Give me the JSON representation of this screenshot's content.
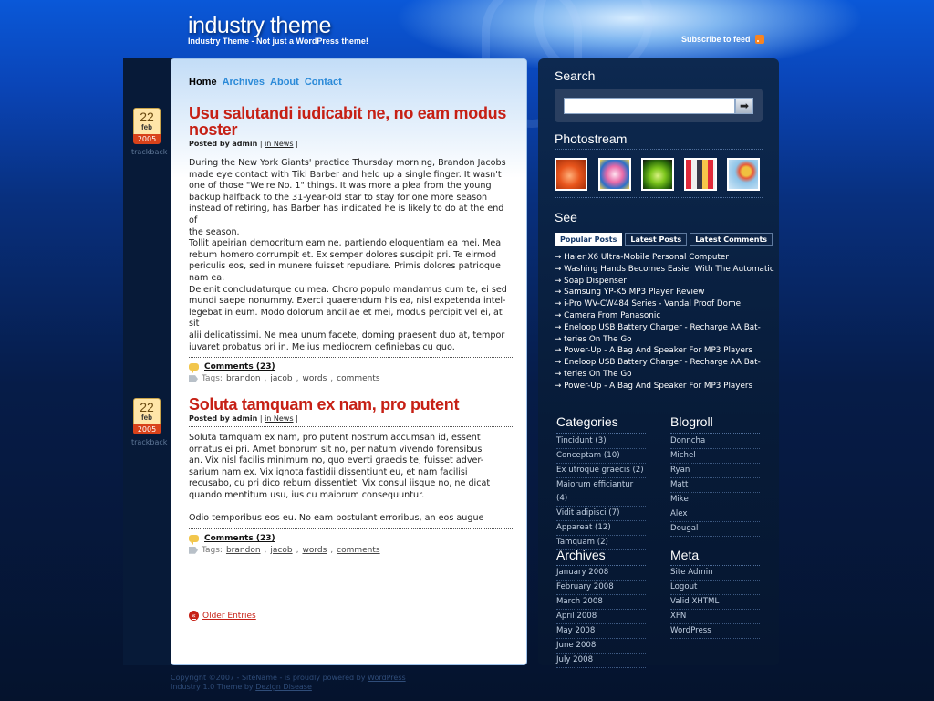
{
  "header": {
    "site_title": "industry theme",
    "tagline": "Industry Theme - Not just a WordPress theme!",
    "subscribe_label": "Subscribe to feed"
  },
  "nav": [
    "Home",
    "Archives",
    "About",
    "Contact"
  ],
  "posts": [
    {
      "date": {
        "day": "22",
        "month": "feb",
        "year": "2005"
      },
      "trackback": "trackback",
      "title_lines": [
        "Usu salutandi iudicabit ne, no eam modus",
        "noster"
      ],
      "meta": {
        "posted_by_label": "Posted by",
        "author": "admin",
        "category": "in News"
      },
      "body_lines": [
        "During the New York Giants' practice Thursday morning, Brandon Jacobs",
        "made eye contact with Tiki Barber and held up a single finger. It wasn't",
        "one of those \"We're No. 1\" things. It was more a plea from the young",
        "backup halfback to the 31-year-old star to stay for one more season",
        "instead of retiring, has Barber has indicated he is likely to do at the end of",
        "the season.",
        "Tollit apeirian democritum eam ne, partiendo eloquentiam ea mei. Mea",
        "rebum homero corrumpit et. Ex semper dolores suscipit pri. Te eirmod",
        "periculis eos, sed in munere fuisset repudiare. Primis dolores patrioque",
        "nam ea.",
        "Delenit concludaturque cu mea. Choro populo mandamus cum te, ei sed",
        "mundi saepe nonummy. Exerci quaerendum his ea, nisl expetenda intel-",
        "legebat in eum. Modo dolorum ancillae et mei, modus percipit vel ei, at sit",
        "alii delicatissimi. Ne mea unum facete, doming praesent duo at, tempor",
        "iuvaret probatus pri in. Melius mediocrem definiebas cu quo."
      ],
      "comments_label": "Comments (23)",
      "tags_label": "Tags:",
      "tags": [
        "brandon",
        "jacob",
        "words",
        "comments"
      ]
    },
    {
      "date": {
        "day": "22",
        "month": "feb",
        "year": "2005"
      },
      "trackback": "trackback",
      "title_lines": [
        "Soluta tamquam ex nam, pro putent"
      ],
      "meta": {
        "posted_by_label": "Posted by",
        "author": "admin",
        "category": "in News"
      },
      "body_lines": [
        "Soluta tamquam ex nam, pro putent nostrum accumsan id, essent",
        "ornatus ei pri. Amet bonorum sit no, per natum vivendo forensibus",
        "an. Vix nisl facilis minimum no, quo everti graecis te, fuisset adver-",
        "sarium nam ex. Vix ignota fastidii dissentiunt eu, et nam facilisi",
        "recusabo, cu pri dico rebum dissentiet. Vix consul iisque no, ne dicat",
        "quando mentitum usu, ius cu maiorum consequuntur.",
        "",
        "Odio temporibus eos eu. No eam postulant erroribus, an eos augue"
      ],
      "comments_label": "Comments (23)",
      "tags_label": "Tags:",
      "tags": [
        "brandon",
        "jacob",
        "words",
        "comments"
      ]
    }
  ],
  "older_entries": "Older Entries",
  "sidebar": {
    "search_title": "Search",
    "photostream_title": "Photostream",
    "photos": [
      {
        "name": "orange",
        "color": "#e8551c",
        "color2": "#ffb07a"
      },
      {
        "name": "candy",
        "color": "#e86aa8",
        "color2": "#ffd2e6"
      },
      {
        "name": "green-bowl",
        "color": "#4a9a1a",
        "color2": "#c8f070"
      },
      {
        "name": "grid",
        "color": "#c0c0c8",
        "color2": "#e02a3a"
      },
      {
        "name": "balloons",
        "color": "#8ec4e8",
        "color2": "#f0c040"
      }
    ],
    "see_title": "See",
    "tabs": [
      "Popular Posts",
      "Latest Posts",
      "Latest Comments"
    ],
    "see_items": [
      "Haier X6 Ultra-Mobile Personal Computer",
      "Washing Hands Becomes Easier With The Automatic",
      "Soap Dispenser",
      "Samsung YP-K5 MP3 Player Review",
      "i-Pro WV-CW484 Series - Vandal Proof Dome",
      "Camera From Panasonic",
      "Eneloop USB Battery Charger - Recharge AA Bat-",
      "teries On The Go",
      "Power-Up - A Bag And Speaker For MP3 Players",
      "Eneloop USB Battery Charger - Recharge AA Bat-",
      "teries On The Go",
      "Power-Up - A Bag And Speaker For MP3 Players"
    ],
    "categories_title": "Categories",
    "categories": [
      "Tincidunt  (3)",
      "Conceptam (10)",
      "Ex utroque graecis (2)",
      "Maiorum efficiantur (4)",
      "Vidit adipisci (7)",
      "Appareat  (12)",
      "Tamquam (2)"
    ],
    "blogroll_title": "Blogroll",
    "blogroll": [
      "Donncha",
      "Michel",
      "Ryan",
      "Matt",
      "Mike",
      "Alex",
      "Dougal"
    ],
    "archives_title": "Archives",
    "archives": [
      "January 2008",
      "February 2008",
      "March 2008",
      "April 2008",
      "May 2008",
      "June 2008",
      "July 2008"
    ],
    "meta_title": "Meta",
    "meta": [
      "Site Admin",
      "Logout",
      "Valid XHTML",
      "XFN",
      "WordPress"
    ]
  },
  "footer": {
    "line1_text": "Copyright ©2007 - SiteName - is proudly powered by",
    "line1_link": "WordPress",
    "line2_text": "Industry 1.0 Theme by",
    "line2_link": "Dezign Disease"
  }
}
